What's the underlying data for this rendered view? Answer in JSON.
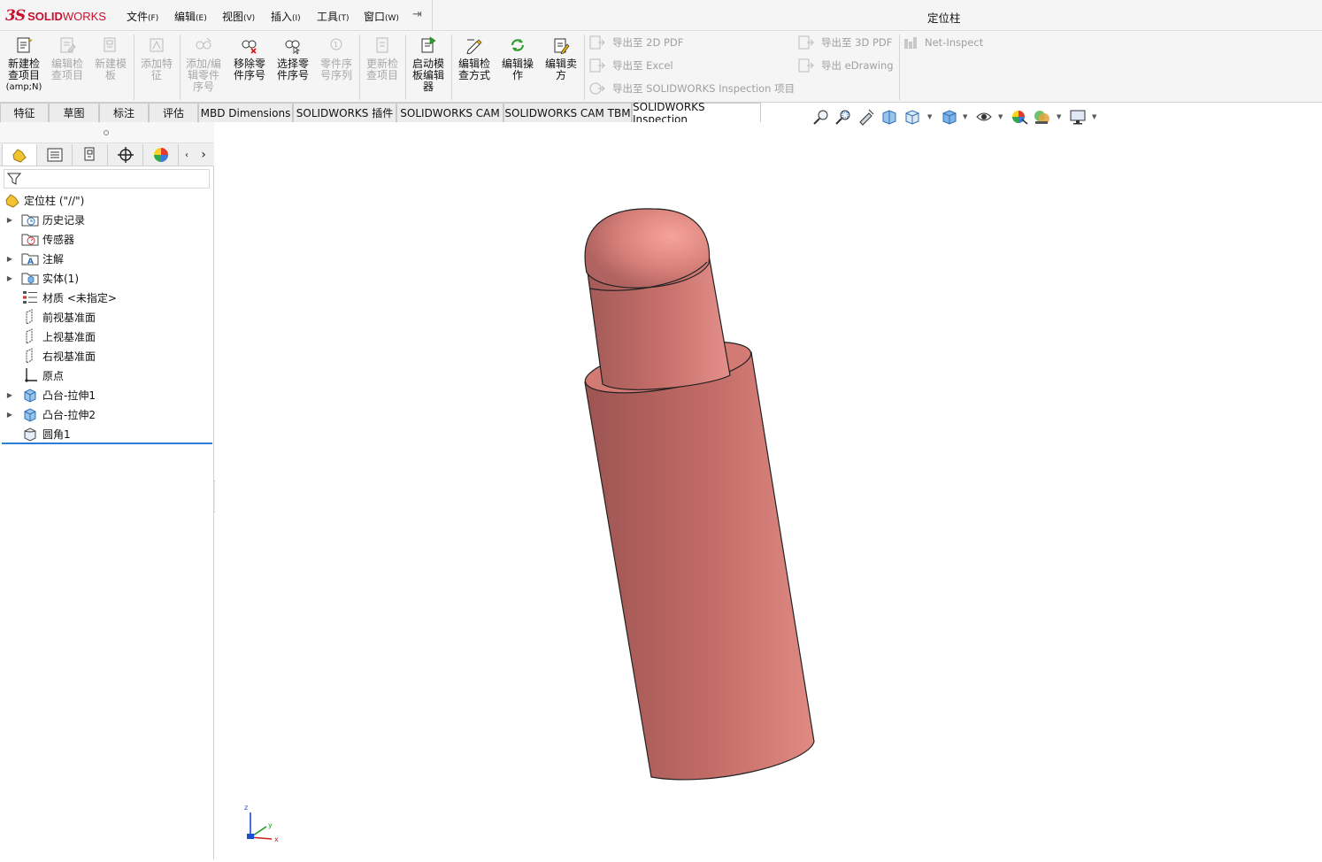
{
  "app": {
    "brand_ds": "3S",
    "brand_name_bold": "SOLID",
    "brand_name_light": "WORKS",
    "document_title": "定位柱"
  },
  "menu": [
    {
      "label": "文件",
      "key": "(F)"
    },
    {
      "label": "编辑",
      "key": "(E)"
    },
    {
      "label": "视图",
      "key": "(V)"
    },
    {
      "label": "插入",
      "key": "(I)"
    },
    {
      "label": "工具",
      "key": "(T)"
    },
    {
      "label": "窗口",
      "key": "(W)"
    }
  ],
  "ribbon": {
    "buttons": [
      {
        "line1": "新建检",
        "line2": "查项目",
        "line3": "",
        "sub": "(amp;N)",
        "enabled": true
      },
      {
        "line1": "编辑检",
        "line2": "查项目",
        "line3": "",
        "sub": "",
        "enabled": false
      },
      {
        "line1": "新建模",
        "line2": "板",
        "line3": "",
        "sub": "",
        "enabled": false
      },
      {
        "line1": "添加特",
        "line2": "征",
        "line3": "",
        "sub": "",
        "enabled": false
      },
      {
        "line1": "添加/编",
        "line2": "辑零件",
        "line3": "序号",
        "sub": "",
        "enabled": false
      },
      {
        "line1": "移除零",
        "line2": "件序号",
        "line3": "",
        "sub": "",
        "enabled": true
      },
      {
        "line1": "选择零",
        "line2": "件序号",
        "line3": "",
        "sub": "",
        "enabled": true
      },
      {
        "line1": "零件序",
        "line2": "号序列",
        "line3": "",
        "sub": "",
        "enabled": false
      },
      {
        "line1": "更新检",
        "line2": "查项目",
        "line3": "",
        "sub": "",
        "enabled": false
      },
      {
        "line1": "启动模",
        "line2": "板编辑",
        "line3": "器",
        "sub": "",
        "enabled": true
      },
      {
        "line1": "编辑检",
        "line2": "查方式",
        "line3": "",
        "sub": "",
        "enabled": true
      },
      {
        "line1": "编辑操",
        "line2": "作",
        "line3": "",
        "sub": "",
        "enabled": true
      },
      {
        "line1": "编辑卖",
        "line2": "方",
        "line3": "",
        "sub": "",
        "enabled": true
      }
    ],
    "exports": {
      "pdf2d": "导出至 2D PDF",
      "excel": "导出至 Excel",
      "inspection": "导出至 SOLIDWORKS Inspection 项目",
      "pdf3d": "导出至 3D PDF",
      "edrawing": "导出 eDrawing",
      "net_inspect": "Net-Inspect"
    }
  },
  "tabs": [
    "特征",
    "草图",
    "标注",
    "评估",
    "MBD Dimensions",
    "SOLIDWORKS 插件",
    "SOLIDWORKS CAM",
    "SOLIDWORKS CAM TBM",
    "SOLIDWORKS Inspection"
  ],
  "active_tab": "SOLIDWORKS Inspection",
  "tree": {
    "root": "定位柱 (\"//\")",
    "items": [
      {
        "label": "历史记录",
        "icon": "history-folder-icon",
        "expandable": true
      },
      {
        "label": "传感器",
        "icon": "sensor-folder-icon",
        "expandable": false
      },
      {
        "label": "注解",
        "icon": "annotation-folder-icon",
        "expandable": true
      },
      {
        "label": "实体(1)",
        "icon": "solid-bodies-folder-icon",
        "expandable": true
      },
      {
        "label": "材质 <未指定>",
        "icon": "material-icon",
        "expandable": false
      },
      {
        "label": "前视基准面",
        "icon": "plane-icon",
        "expandable": false
      },
      {
        "label": "上视基准面",
        "icon": "plane-icon",
        "expandable": false
      },
      {
        "label": "右视基准面",
        "icon": "plane-icon",
        "expandable": false
      },
      {
        "label": "原点",
        "icon": "origin-icon",
        "expandable": false
      },
      {
        "label": "凸台-拉伸1",
        "icon": "boss-extrude-icon",
        "expandable": true
      },
      {
        "label": "凸台-拉伸2",
        "icon": "boss-extrude-icon",
        "expandable": true
      },
      {
        "label": "圆角1",
        "icon": "fillet-icon",
        "expandable": false
      }
    ]
  },
  "triad": {
    "x": "x",
    "y": "y",
    "z": "z"
  },
  "colors": {
    "model_base": "#c96f6a",
    "model_light": "#e58f8a",
    "model_dark": "#a85a56",
    "brand_red": "#c8102e",
    "selection_blue": "#2a7fd4"
  }
}
